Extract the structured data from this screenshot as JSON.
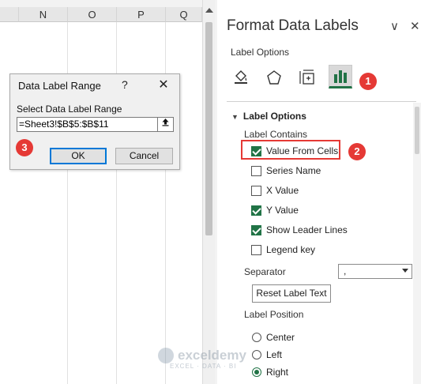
{
  "sheet": {
    "columns": [
      "N",
      "O",
      "P",
      "Q"
    ]
  },
  "dialog": {
    "title": "Data Label Range",
    "help": "?",
    "close": "✕",
    "prompt": "Select Data Label Range",
    "range_value": "=Sheet3!$B$5:$B$11",
    "ok_label": "OK",
    "cancel_label": "Cancel"
  },
  "pane": {
    "title": "Format Data Labels",
    "title_chevron": "∨",
    "title_close": "✕",
    "subtitle": "Label Options",
    "tabs": [
      "fill-line-icon",
      "effects-pentagon-icon",
      "size-properties-icon",
      "label-options-bar-chart-icon"
    ],
    "active_tab": 3,
    "section_title": "Label Options",
    "label_contains": "Label Contains",
    "checkboxes": [
      {
        "label": "Value From Cells",
        "checked": true
      },
      {
        "label": "Series Name",
        "checked": false
      },
      {
        "label": "X Value",
        "checked": false
      },
      {
        "label": "Y Value",
        "checked": true
      },
      {
        "label": "Show Leader Lines",
        "checked": true
      },
      {
        "label": "Legend key",
        "checked": false
      }
    ],
    "separator_label": "Separator",
    "separator_value": ",",
    "reset_label": "Reset Label Text",
    "label_position": "Label Position",
    "positions": [
      {
        "label": "Center",
        "checked": false
      },
      {
        "label": "Left",
        "checked": false
      },
      {
        "label": "Right",
        "checked": true
      }
    ]
  },
  "badges": [
    "1",
    "2",
    "3"
  ],
  "watermark": {
    "name": "exceldemy",
    "tagline": "EXCEL · DATA · BI"
  },
  "colors": {
    "accent_green": "#217346",
    "badge_red": "#e53935"
  }
}
